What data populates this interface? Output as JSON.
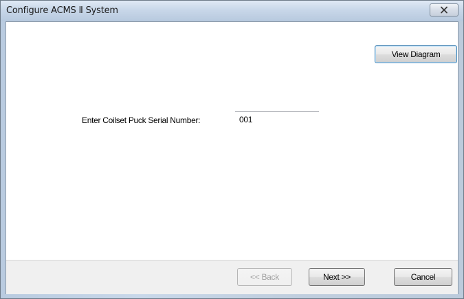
{
  "window": {
    "title": "Configure ACMS Ⅱ System",
    "close_icon": "close-icon"
  },
  "main": {
    "view_diagram_label": "View Diagram",
    "serial_label": "Enter Coilset Puck Serial Number:",
    "serial_value": "001"
  },
  "footer": {
    "back_label": "<< Back",
    "next_label": "Next >>",
    "cancel_label": "Cancel"
  }
}
